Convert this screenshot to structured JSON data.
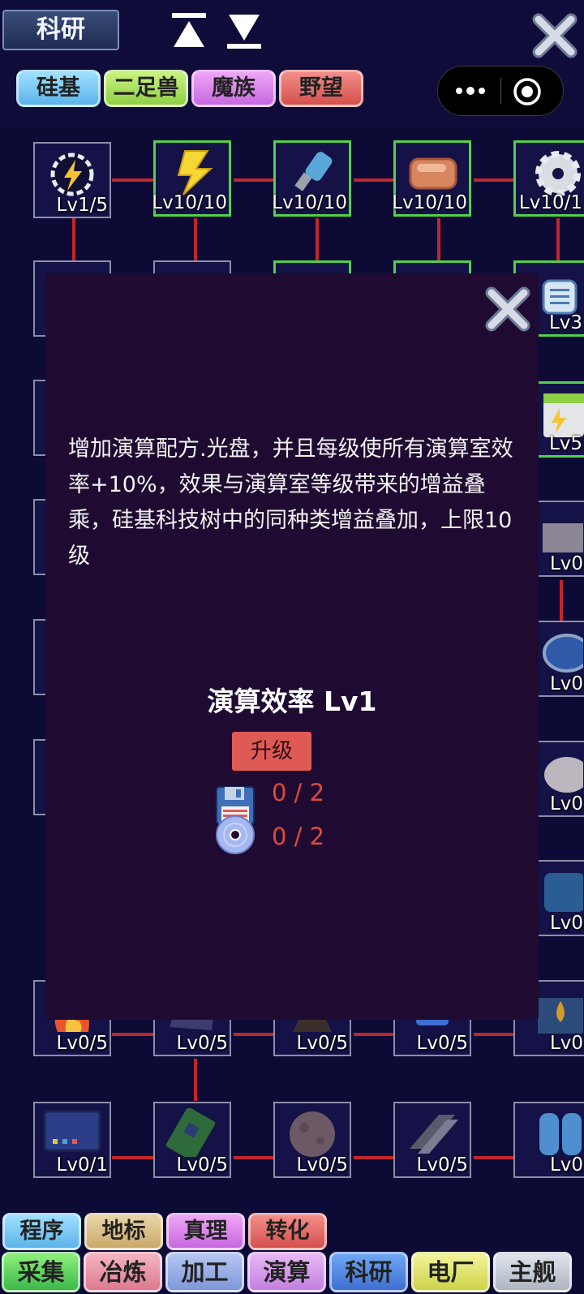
{
  "header": {
    "title": "科研",
    "tree_tabs": [
      "硅基",
      "二足兽",
      "魔族",
      "野望"
    ]
  },
  "tree": {
    "row1": [
      "Lv1/5",
      "Lv10/10",
      "Lv10/10",
      "Lv10/10",
      "Lv10/1"
    ],
    "row_right": [
      "Lv3",
      "Lv5",
      "Lv0",
      "Lv0",
      "Lv0",
      "Lv0"
    ],
    "row_bottom1": [
      "Lv0/5",
      "Lv0/5",
      "Lv0/5",
      "Lv0/5",
      "Lv0"
    ],
    "row_bottom2": [
      "Lv0/1",
      "Lv0/5",
      "Lv0/5",
      "Lv0/5",
      "Lv0"
    ]
  },
  "modal": {
    "description": "增加演算配方.光盘，并且每级使所有演算室效率+10%，效果与演算室等级带来的增益叠乘，硅基科技树中的同种类增益叠加，上限10级",
    "tech_name": "演算效率 Lv1",
    "upgrade_label": "升级",
    "costs": [
      {
        "icon": "floppy-disk-icon",
        "value": "0 / 2"
      },
      {
        "icon": "disc-icon",
        "value": "0 / 2"
      }
    ]
  },
  "bottom_nav": {
    "row1": [
      "程序",
      "地标",
      "真理",
      "转化"
    ],
    "row2": [
      "采集",
      "冶炼",
      "加工",
      "演算",
      "科研",
      "电厂",
      "主舰"
    ]
  },
  "colors": {
    "background": "#0d0b36",
    "modal": "#1f0b31",
    "completed_border": "#4fd24a",
    "connector": "#c0262a",
    "cost_text": "#e0483f",
    "upgrade_button": "#e05a55"
  }
}
